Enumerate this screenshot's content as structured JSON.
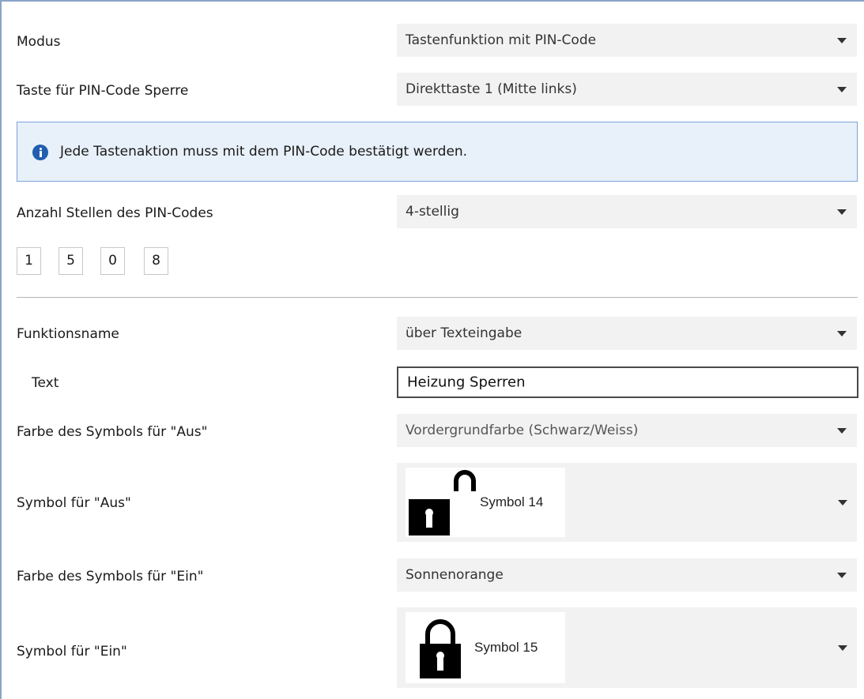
{
  "rows": {
    "modus": {
      "label": "Modus",
      "value": "Tastenfunktion mit PIN-Code"
    },
    "taste": {
      "label": "Taste für PIN-Code Sperre",
      "value": "Direkttaste 1 (Mitte links)"
    },
    "anzahl": {
      "label": "Anzahl Stellen des PIN-Codes",
      "value": "4-stellig"
    },
    "funktionsname": {
      "label": "Funktionsname",
      "value": "über Texteingabe"
    },
    "text": {
      "label": "Text",
      "value": "Heizung Sperren"
    },
    "farbe_aus": {
      "label": "Farbe des Symbols für \"Aus\"",
      "value": "Vordergrundfarbe (Schwarz/Weiss)"
    },
    "symbol_aus": {
      "label": "Symbol für \"Aus\"",
      "value": "Symbol 14",
      "icon": "unlocked-padlock-icon"
    },
    "farbe_ein": {
      "label": "Farbe des Symbols für \"Ein\"",
      "value": "Sonnenorange"
    },
    "symbol_ein": {
      "label": "Symbol für \"Ein\"",
      "value": "Symbol 15",
      "icon": "locked-padlock-icon"
    }
  },
  "info": {
    "text": "Jede Tastenaktion muss mit dem PIN-Code bestätigt werden.",
    "icon": "info-icon"
  },
  "pin_digits": [
    "1",
    "5",
    "0",
    "8"
  ],
  "colors": {
    "info_bg": "#e8f0f9",
    "info_border": "#7aa3d6",
    "info_icon": "#1f5fae",
    "field_bg": "#f2f2f2"
  }
}
